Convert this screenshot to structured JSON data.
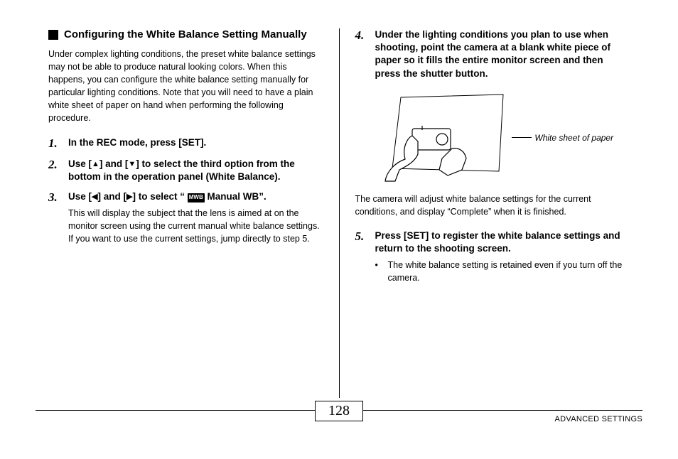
{
  "left": {
    "heading": "Configuring the White Balance Setting Manually",
    "intro": "Under complex lighting conditions, the preset white balance settings may not be able to produce natural looking colors. When this happens, you can configure the white balance setting manually for particular lighting conditions. Note that you will need to have a plain white sheet of paper on hand when performing the following procedure.",
    "step1": {
      "num": "1.",
      "title": "In the REC mode, press [SET]."
    },
    "step2": {
      "num": "2.",
      "title_pre": "Use [",
      "title_mid1": "] and [",
      "title_post": "] to select the third option from the bottom in the operation panel (White Balance)."
    },
    "step3": {
      "num": "3.",
      "title_pre": "Use [",
      "title_mid1": "] and [",
      "title_mid2": "] to select “ ",
      "mwb": "MWB",
      "title_post": "  Manual WB”.",
      "desc": "This will display the subject that the lens is aimed at on the monitor screen using the current manual white balance settings. If you want to use the current settings, jump directly to step 5."
    }
  },
  "right": {
    "step4": {
      "num": "4.",
      "title": "Under the lighting conditions you plan to use when shooting, point the camera at a blank white piece of paper so it fills the entire monitor screen and then press the shutter button."
    },
    "illus_caption": "White sheet of paper",
    "note": "The camera will adjust white balance settings for the current conditions, and display “Complete” when it is finished.",
    "step5": {
      "num": "5.",
      "title": "Press [SET] to register the white balance settings and return to the shooting screen.",
      "bullet": "The white balance setting is retained even if you turn off the camera."
    }
  },
  "footer": {
    "page": "128",
    "section": "ADVANCED SETTINGS"
  }
}
